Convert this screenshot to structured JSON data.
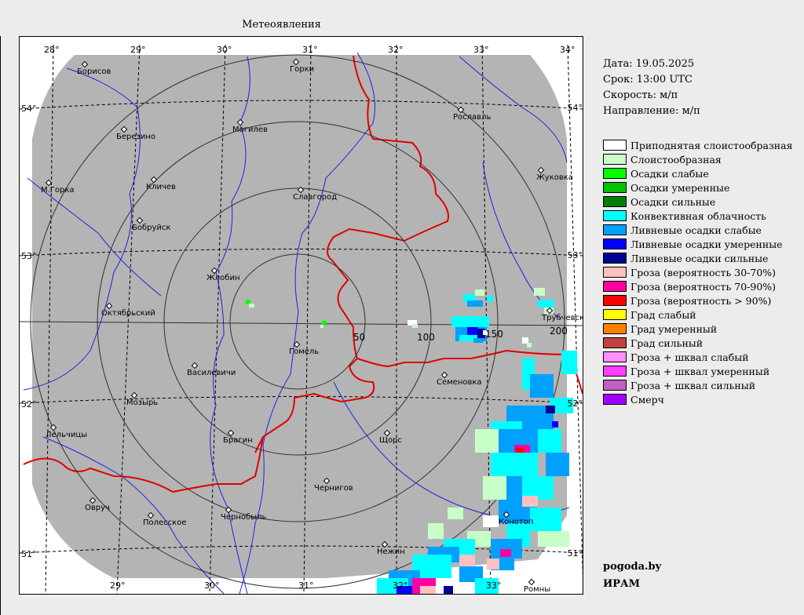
{
  "title": "Метеоявления",
  "info": {
    "date": "Дата: 19.05.2025",
    "term": "Срок: 13:00 UTC",
    "speed": "Скорость: м/п",
    "direction": "Направление: м/п"
  },
  "legend": [
    {
      "label": "Приподнятая слоистообразная",
      "color": "#ffffff"
    },
    {
      "label": "Слоистообразная",
      "color": "#c8ffc8"
    },
    {
      "label": "Осадки слабые",
      "color": "#00ff00"
    },
    {
      "label": "Осадки умеренные",
      "color": "#00c000"
    },
    {
      "label": "Осадки сильные",
      "color": "#008000"
    },
    {
      "label": "Конвективная облачность",
      "color": "#00ffff"
    },
    {
      "label": "Ливневые осадки слабые",
      "color": "#00a0ff"
    },
    {
      "label": "Ливневые осадки умеренные",
      "color": "#0000ff"
    },
    {
      "label": "Ливневые осадки сильные",
      "color": "#000090"
    },
    {
      "label": "Гроза (вероятность 30-70%)",
      "color": "#ffc0c0"
    },
    {
      "label": "Гроза (вероятность 70-90%)",
      "color": "#ff00a0"
    },
    {
      "label": "Гроза (вероятность > 90%)",
      "color": "#ff0000"
    },
    {
      "label": "Град слабый",
      "color": "#ffff00"
    },
    {
      "label": "Град умеренный",
      "color": "#ff8000"
    },
    {
      "label": "Град сильный",
      "color": "#c04040"
    },
    {
      "label": "Гроза + шквал слабый",
      "color": "#ff90ff"
    },
    {
      "label": "Гроза + шквал умеренный",
      "color": "#ff40ff"
    },
    {
      "label": "Гроза + шквал сильный",
      "color": "#c060c0"
    },
    {
      "label": "Смерч",
      "color": "#a000ff"
    }
  ],
  "credits": {
    "site": "pogoda.by",
    "org": "ИРАМ"
  },
  "map": {
    "top_lon_labels": [
      "28°",
      "29°",
      "30°",
      "31°",
      "32°",
      "33°",
      "34°"
    ],
    "bottom_lon_labels": [
      "29°",
      "30°",
      "31°",
      "32°",
      "33°"
    ],
    "lat_labels": [
      "54°",
      "53°",
      "52°",
      "51°"
    ],
    "range_labels": [
      "50",
      "100",
      "150",
      "200"
    ],
    "towns": [
      "Борисов",
      "Горки",
      "Рославль",
      "Березино",
      "Могилев",
      "Жуковка",
      "М.Горка",
      "Кличев",
      "Славгород",
      "Бобруйск",
      "Жлобин",
      "Октябрьский",
      "Трубчевск",
      "Гомель",
      "Василевичи",
      "Семеновка",
      "Мозырь",
      "Лельчицы",
      "Брагин",
      "Щорс",
      "Чернигов",
      "Овруч",
      "Полесское",
      "Чернобыль",
      "Конотоп",
      "Нежин",
      "Ромны"
    ]
  }
}
